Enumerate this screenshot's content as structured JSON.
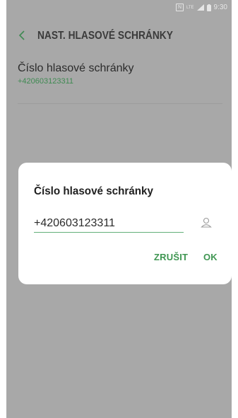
{
  "statusbar": {
    "lte": "LTE",
    "time": "9:30",
    "nfc": "N"
  },
  "header": {
    "title": "NAST. HLASOVÉ SCHRÁNKY",
    "back_icon": "chevron-left-icon"
  },
  "setting": {
    "label": "Číslo hlasové schránky",
    "value": "+420603123311"
  },
  "dialog": {
    "title": "Číslo hlasové schránky",
    "input_value": "+420603123311",
    "contact_icon": "contact-icon",
    "cancel_label": "ZRUŠIT",
    "ok_label": "OK"
  },
  "colors": {
    "accent": "#3f9652",
    "overlay": "#a8a8a8",
    "dialog_bg": "#ffffff"
  }
}
